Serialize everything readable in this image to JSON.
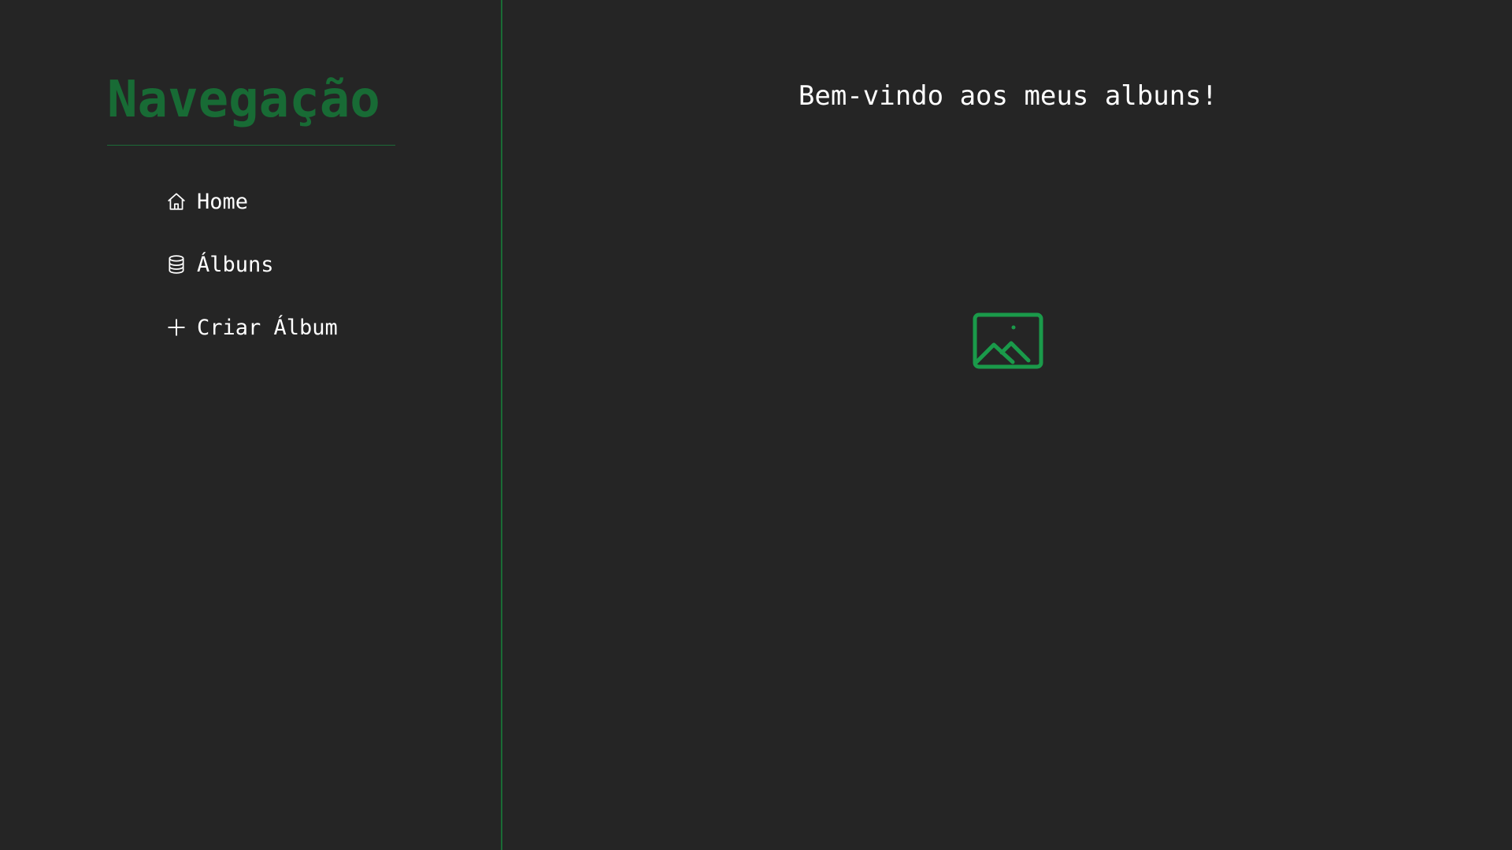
{
  "sidebar": {
    "title": "Navegação",
    "items": [
      {
        "label": "Home",
        "icon": "home-icon"
      },
      {
        "label": "Álbuns",
        "icon": "database-icon"
      },
      {
        "label": "Criar Álbum",
        "icon": "plus-icon"
      }
    ]
  },
  "main": {
    "welcome": "Bem-vindo aos meus albuns!",
    "hero_icon": "image-icon"
  },
  "colors": {
    "background": "#252525",
    "accent": "#1a9a4a",
    "title": "#186b35",
    "text": "#ffffff"
  }
}
